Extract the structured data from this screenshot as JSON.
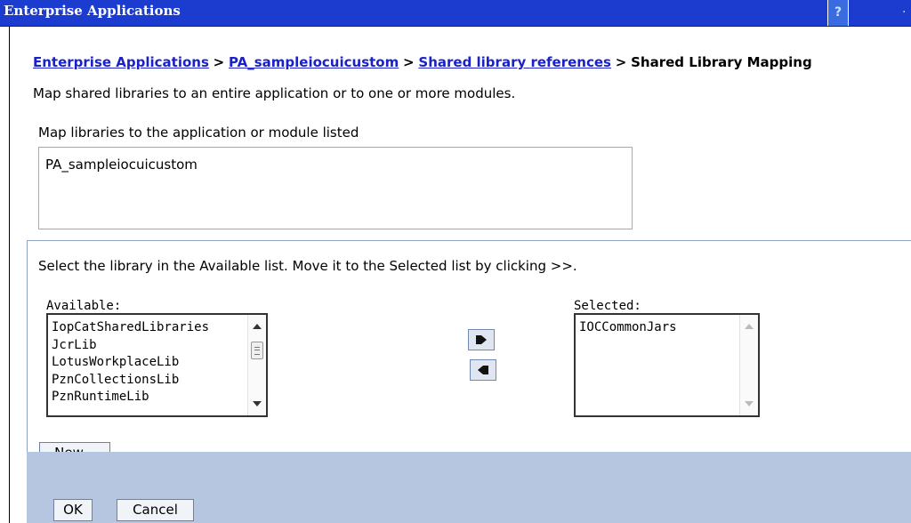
{
  "window": {
    "title": "Enterprise Applications",
    "help_label": "?"
  },
  "breadcrumb": {
    "items": [
      "Enterprise Applications",
      "PA_sampleiocuicustom",
      "Shared library references"
    ],
    "separator": ">",
    "current": "Shared Library Mapping"
  },
  "description": "Map shared libraries to an entire application or to one or more modules.",
  "mapping": {
    "label": "Map libraries to the application or module listed",
    "value": "PA_sampleiocuicustom"
  },
  "libraries": {
    "instruction": "Select the library in the Available list. Move it to the Selected list by clicking >>.",
    "available_label": "Available:",
    "available": [
      "IopCatSharedLibraries",
      "JcrLib",
      "LotusWorkplaceLib",
      "PznCollectionsLib",
      "PznRuntimeLib"
    ],
    "selected_label": "Selected:",
    "selected": [
      "IOCCommonJars"
    ]
  },
  "buttons": {
    "new": "New...",
    "ok": "OK",
    "cancel": "Cancel"
  },
  "icons": {
    "add": "right-arrow-icon",
    "remove": "left-arrow-icon"
  }
}
